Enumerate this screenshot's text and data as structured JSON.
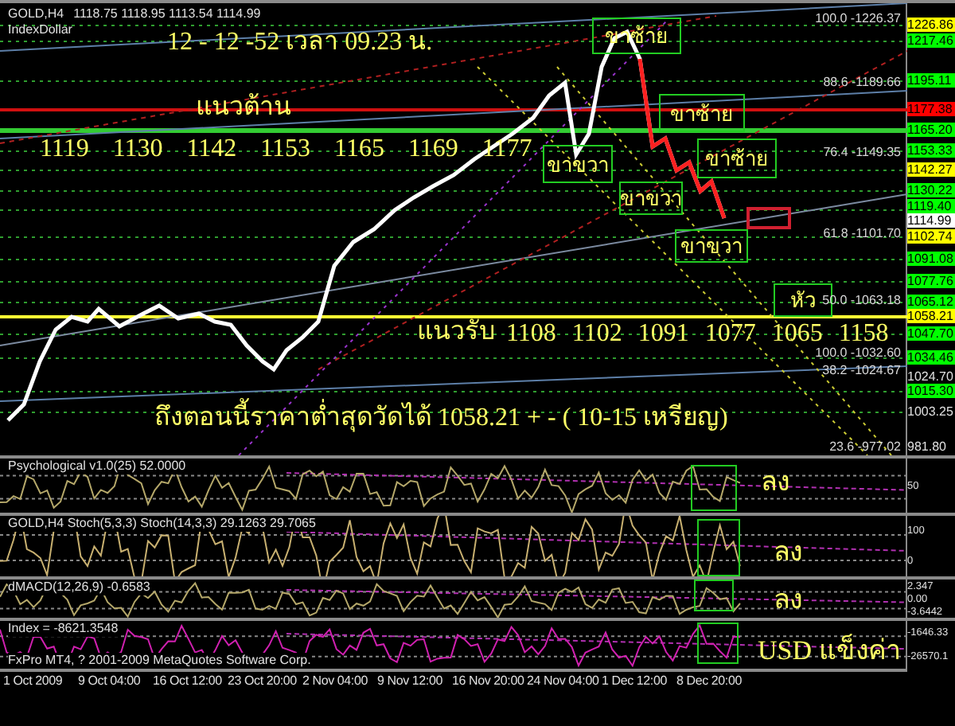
{
  "header": {
    "symbol": "GOLD,H4",
    "ohlc": "1118.75 1118.95 1113.54 1114.99",
    "indicator": "IndexDollar"
  },
  "notes": {
    "date": "12 - 12 -52 เวลา 09.23 น.",
    "resistance_label": "แนวต้าน",
    "resistance_levels": "1119 1130 1142 1153 1165 1169 1177",
    "support_label": "แนวรับ",
    "support_levels": "1108 1102 1091 1077 1065 1158",
    "low_note": "ถึงตอนนี้ราคาต่ำสุดวัดได้ 1058.21 + - ( 10-15 เหรียญ)"
  },
  "pattern_labels": [
    {
      "text": "ขาซ้าย"
    },
    {
      "text": "ขาซ้าย"
    },
    {
      "text": "ขาซ้าย"
    },
    {
      "text": "ขาขวา"
    },
    {
      "text": "ขาขวา"
    },
    {
      "text": "ขาขวา"
    },
    {
      "text": "หัว"
    }
  ],
  "fib_levels": [
    "100.0 -1226.37",
    "88.6 -1189.66",
    "76.4 -1149.35",
    "61.8 -1101.70",
    "50.0 -1063.18",
    "100.0 -1032.60",
    "38.2 -1024.67",
    "23.6 -977.02"
  ],
  "price_axis": [
    {
      "text": "1226.86",
      "kind": "tag",
      "color": "#ffff00"
    },
    {
      "text": "1217.46",
      "kind": "tag",
      "color": "#00ff00"
    },
    {
      "text": "1195.11",
      "kind": "tag",
      "color": "#00ff00"
    },
    {
      "text": "1177.38",
      "kind": "tag",
      "color": "#ff0000"
    },
    {
      "text": "1165.20",
      "kind": "tag",
      "color": "#00ff00"
    },
    {
      "text": "1153.33",
      "kind": "tag",
      "color": "#00ff00"
    },
    {
      "text": "1142.27",
      "kind": "tag",
      "color": "#ffff00"
    },
    {
      "text": "1130.22",
      "kind": "tag",
      "color": "#00ff00"
    },
    {
      "text": "1119.40",
      "kind": "tag",
      "color": "#00ff00"
    },
    {
      "text": "1114.99",
      "kind": "tag",
      "color": "#ffffff"
    },
    {
      "text": "1102.74",
      "kind": "tag",
      "color": "#ffff00"
    },
    {
      "text": "1091.08",
      "kind": "tag",
      "color": "#00ff00"
    },
    {
      "text": "1077.76",
      "kind": "tag",
      "color": "#00ff00"
    },
    {
      "text": "1065.12",
      "kind": "tag",
      "color": "#00ff00"
    },
    {
      "text": "1058.21",
      "kind": "tag",
      "color": "#ffff00"
    },
    {
      "text": "1047.70",
      "kind": "tag",
      "color": "#00ff00"
    },
    {
      "text": "1034.46",
      "kind": "tag",
      "color": "#00ff00"
    },
    {
      "text": "1024.70",
      "kind": "plain"
    },
    {
      "text": "1015.30",
      "kind": "tag",
      "color": "#00ff00"
    },
    {
      "text": "1003.25",
      "kind": "plain"
    },
    {
      "text": "981.80",
      "kind": "plain"
    }
  ],
  "indicators": [
    {
      "title": "Psychological v1.0(25) 52.0000",
      "signal": "ลง",
      "axis": [
        "50"
      ]
    },
    {
      "title": "GOLD,H4 Stoch(5,3,3) Stoch(14,3,3) 29.1263 29.7065",
      "signal": "ลง",
      "axis": [
        "100",
        "0"
      ]
    },
    {
      "title": "dMACD(12,26,9) -0.6583",
      "signal": "ลง",
      "axis": [
        "2.347",
        "0.00",
        "-3.6442"
      ]
    },
    {
      "title": "Index = -8621.3548",
      "signal": "USD แข็งค่า",
      "axis": [
        "-1646.33",
        "-26570.1"
      ],
      "footer": "FxPro MT4, ? 2001-2009 MetaQuotes Software Corp."
    }
  ],
  "time_axis": [
    "1 Oct 2009",
    "9 Oct 04:00",
    "16 Oct 12:00",
    "23 Oct 20:00",
    "2 Nov 04:00",
    "9 Nov 12:00",
    "16 Nov 20:00",
    "24 Nov 04:00",
    "1 Dec 12:00",
    "8 Dec 20:00"
  ]
}
